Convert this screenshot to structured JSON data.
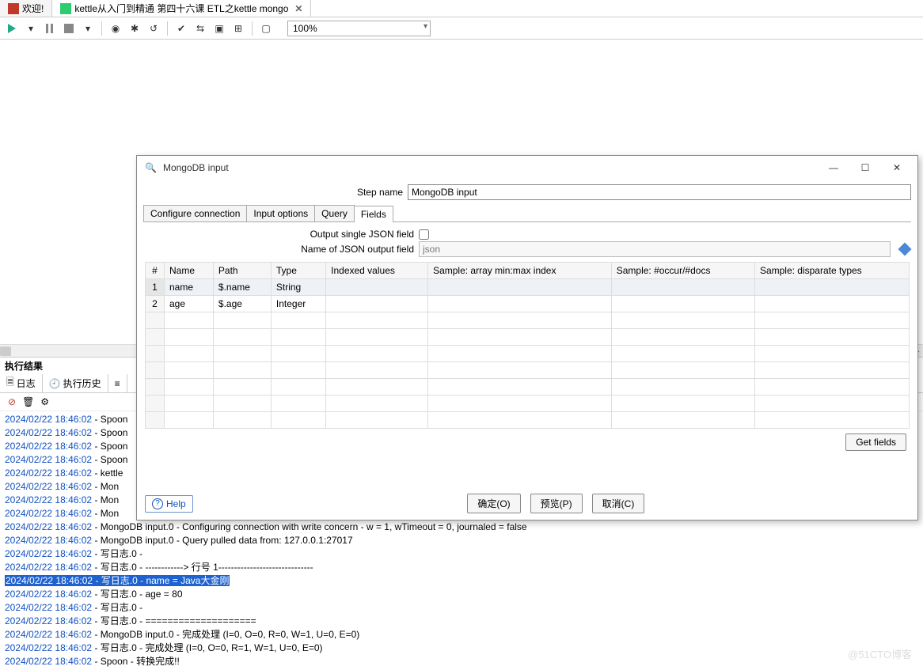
{
  "tabs": [
    {
      "label": "欢迎!",
      "icon_color": "#c0392b"
    },
    {
      "label": "kettle从入门到精通 第四十六课 ETL之kettle mongo",
      "icon_color": "#2ecc71"
    }
  ],
  "toolbar": {
    "zoom": "100%"
  },
  "results": {
    "title": "执行结果",
    "tabs": {
      "log": "日志",
      "history": "执行历史"
    },
    "log": [
      {
        "ts": "2024/02/22 18:46:02",
        "text": "Spoon"
      },
      {
        "ts": "2024/02/22 18:46:02",
        "text": "Spoon"
      },
      {
        "ts": "2024/02/22 18:46:02",
        "text": "Spoon"
      },
      {
        "ts": "2024/02/22 18:46:02",
        "text": "Spoon"
      },
      {
        "ts": "2024/02/22 18:46:02",
        "text": "kettle"
      },
      {
        "ts": "2024/02/22 18:46:02",
        "text": "Mon"
      },
      {
        "ts": "2024/02/22 18:46:02",
        "text": "Mon"
      },
      {
        "ts": "2024/02/22 18:46:02",
        "text": "Mon"
      },
      {
        "ts": "2024/02/22 18:46:02",
        "text": "MongoDB input.0 - Configuring connection with write concern - w = 1, wTimeout = 0, journaled = false"
      },
      {
        "ts": "2024/02/22 18:46:02",
        "text": "MongoDB input.0 - Query pulled data from: 127.0.0.1:27017"
      },
      {
        "ts": "2024/02/22 18:46:02",
        "text": "写日志.0 - "
      },
      {
        "ts": "2024/02/22 18:46:02",
        "text": "写日志.0 - ------------> 行号 1------------------------------"
      },
      {
        "ts": "2024/02/22 18:46:02",
        "text": "写日志.0 - name = Java大金刚",
        "hl": true
      },
      {
        "ts": "2024/02/22 18:46:02",
        "text": "写日志.0 - age = 80"
      },
      {
        "ts": "2024/02/22 18:46:02",
        "text": "写日志.0 - "
      },
      {
        "ts": "2024/02/22 18:46:02",
        "text": "写日志.0 - ===================="
      },
      {
        "ts": "2024/02/22 18:46:02",
        "text": "MongoDB input.0 - 完成处理 (I=0, O=0, R=0, W=1, U=0, E=0)"
      },
      {
        "ts": "2024/02/22 18:46:02",
        "text": "写日志.0 - 完成处理 (I=0, O=0, R=1, W=1, U=0, E=0)"
      },
      {
        "ts": "2024/02/22 18:46:02",
        "text": "Spoon - 转换完成!!"
      }
    ]
  },
  "dialog": {
    "title": "MongoDB input",
    "step_name_label": "Step name",
    "step_name_value": "MongoDB input",
    "tabs": [
      "Configure connection",
      "Input options",
      "Query",
      "Fields"
    ],
    "active_tab": 3,
    "fields_pane": {
      "output_json_label": "Output single JSON field",
      "output_json_checked": false,
      "json_name_label": "Name of JSON output field",
      "json_name_value": "json",
      "columns": [
        "#",
        "Name",
        "Path",
        "Type",
        "Indexed values",
        "Sample: array min:max index",
        "Sample: #occur/#docs",
        "Sample: disparate types"
      ],
      "rows": [
        {
          "n": "1",
          "name": "name",
          "path": "$.name",
          "type": "String"
        },
        {
          "n": "2",
          "name": "age",
          "path": "$.age",
          "type": "Integer"
        }
      ],
      "get_fields": "Get fields"
    },
    "buttons": {
      "help": "Help",
      "ok": "确定(O)",
      "preview": "预览(P)",
      "cancel": "取消(C)"
    }
  },
  "watermark": "@51CTO博客"
}
